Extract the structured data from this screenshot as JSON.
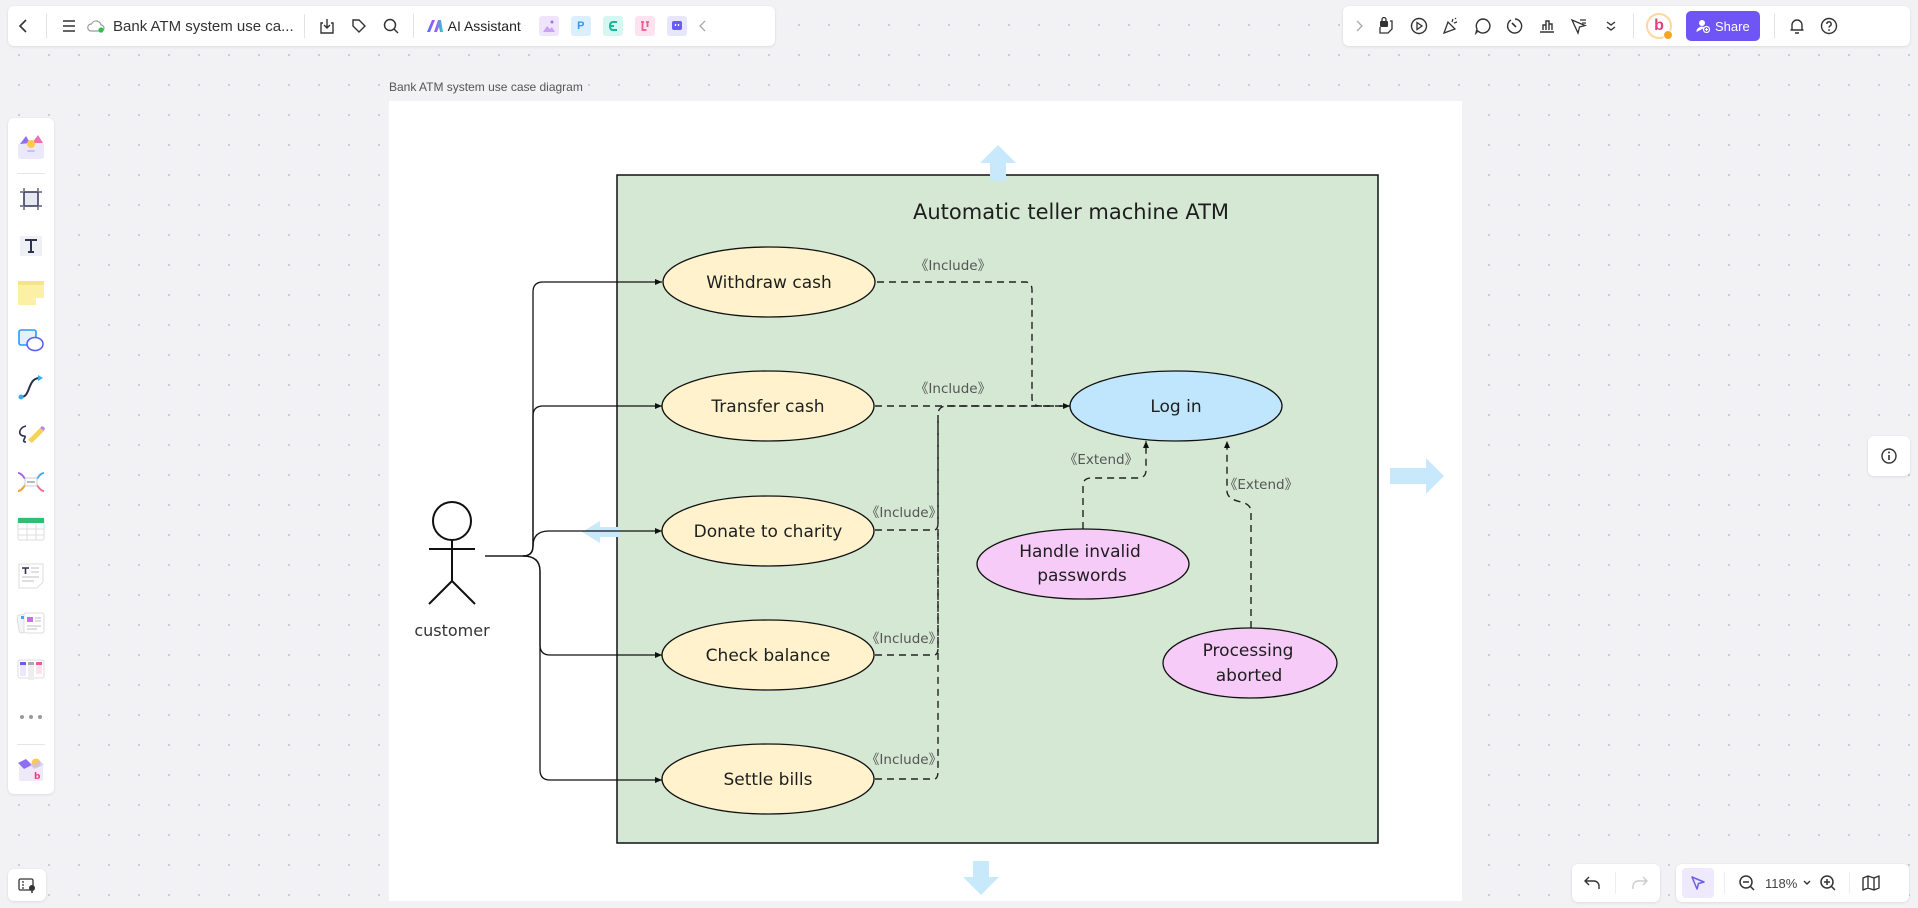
{
  "toolbar_left": {
    "back_icon": "chevron-left-icon",
    "menu_icon": "hamburger-icon",
    "cloud_icon": "cloud-synced-icon",
    "document_title": "Bank ATM system use ca...",
    "download_icon": "download-icon",
    "tag_icon": "tag-icon",
    "search_icon": "search-icon",
    "ai_assistant_label": "AI Assistant",
    "apps": [
      {
        "name": "image-generator",
        "glyph": "▲",
        "bg": "#efe4fb",
        "fg": "#b58ae8"
      },
      {
        "name": "presentation",
        "glyph": "P",
        "bg": "#dcefff",
        "fg": "#2b9af3"
      },
      {
        "name": "mindmap",
        "glyph": "<",
        "bg": "#d6f7f1",
        "fg": "#1bbfa6"
      },
      {
        "name": "flowchart",
        "glyph": "⌥",
        "bg": "#fde3ee",
        "fg": "#ee5a9c"
      },
      {
        "name": "chat",
        "glyph": "▪",
        "bg": "#e8e6fd",
        "fg": "#6b5cf0"
      }
    ],
    "collapse_icon": "chevron-left-icon"
  },
  "toolbar_right": {
    "expand_icon": "chevron-right-icon",
    "icons": [
      "template-icon",
      "play-icon",
      "celebrate-icon",
      "comment-icon",
      "timer-icon",
      "vote-icon",
      "laser-pointer-icon",
      "more-chevrons-icon"
    ],
    "avatar_letter": "b",
    "share_label": "Share",
    "bell_icon": "bell-icon",
    "help_icon": "help-icon"
  },
  "left_tools": [
    "templates",
    "frame",
    "text",
    "sticky-note",
    "shapes",
    "connector",
    "pen",
    "mind-map",
    "table",
    "text-document",
    "card",
    "kanban",
    "more",
    "plugins"
  ],
  "canvas": {
    "page_label": "Bank ATM system use case diagram"
  },
  "diagram": {
    "system_title": "Automatic teller machine ATM",
    "actor": {
      "label": "customer"
    },
    "colors": {
      "system_fill": "#d5e8d4",
      "primary_use_case_fill": "#fff2cc",
      "login_fill": "#c0e6fd",
      "extension_fill": "#f6cbf7",
      "arrow_hint": "#c7e9fb"
    },
    "use_cases": [
      {
        "id": "withdraw",
        "label": "Withdraw cash"
      },
      {
        "id": "transfer",
        "label": "Transfer cash"
      },
      {
        "id": "donate",
        "label": "Donate to charity"
      },
      {
        "id": "balance",
        "label": "Check balance"
      },
      {
        "id": "bills",
        "label": "Settle bills"
      },
      {
        "id": "login",
        "label": "Log in"
      },
      {
        "id": "invalid_pw",
        "label_lines": [
          "Handle invalid",
          "passwords"
        ]
      },
      {
        "id": "aborted",
        "label_lines": [
          "Processing",
          "aborted"
        ]
      }
    ],
    "relations": [
      {
        "from": "withdraw",
        "to": "login",
        "label": "《Include》"
      },
      {
        "from": "transfer",
        "to": "login",
        "label": "《Include》"
      },
      {
        "from": "donate",
        "to": "login",
        "label": "《Include》"
      },
      {
        "from": "balance",
        "to": "login",
        "label": "《Include》"
      },
      {
        "from": "bills",
        "to": "login",
        "label": "《Include》"
      },
      {
        "from": "invalid_pw",
        "to": "login",
        "label": "《Extend》"
      },
      {
        "from": "aborted",
        "to": "login",
        "label": "《Extend》"
      }
    ]
  },
  "bottom_controls": {
    "zoom_level": "118%",
    "undo_icon": "undo-icon",
    "redo_icon": "redo-icon",
    "select_icon": "pointer-icon",
    "zoom_out_icon": "zoom-out-icon",
    "zoom_in_icon": "zoom-in-icon",
    "map_icon": "minimap-icon"
  }
}
